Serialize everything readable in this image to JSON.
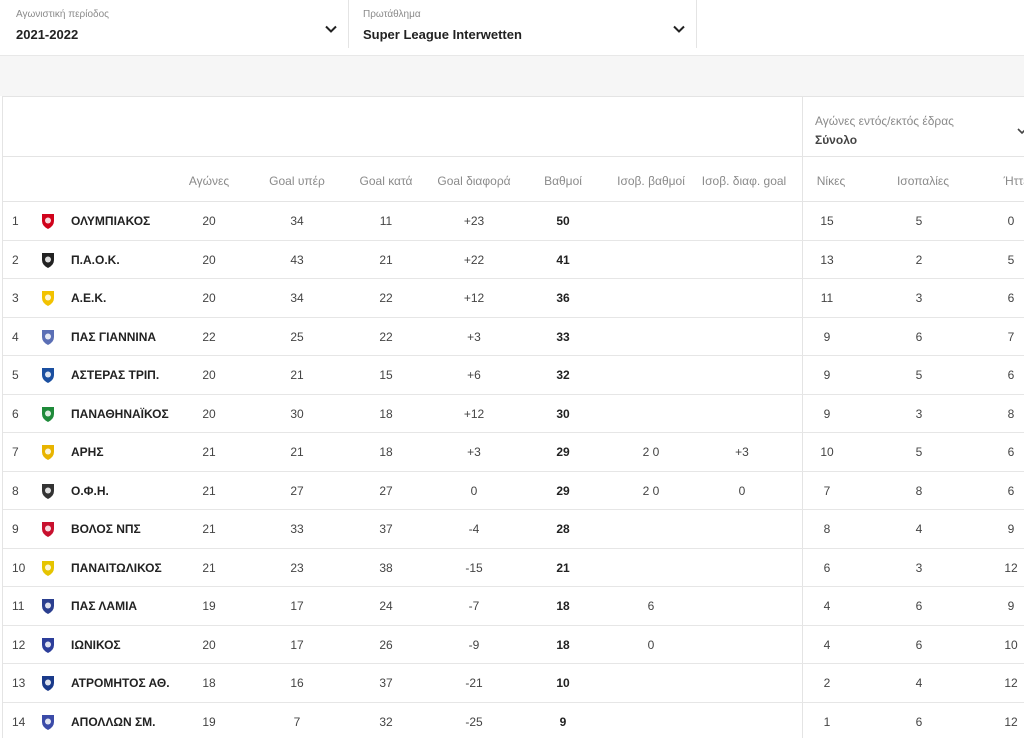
{
  "filters": {
    "season": {
      "label": "Αγωνιστική περίοδος",
      "value": "2021-2022"
    },
    "league": {
      "label": "Πρωτάθλημα",
      "value": "Super League Interwetten"
    }
  },
  "location_filter": {
    "label": "Αγώνες εντός/εκτός έδρας",
    "value": "Σύνολο"
  },
  "columns": {
    "played": "Αγώνες",
    "goals_for": "Goal υπέρ",
    "goals_against": "Goal κατά",
    "goal_diff": "Goal διαφορά",
    "points": "Βαθμοί",
    "tie_points": "Ισοβ. βαθμοί",
    "tie_goal_diff": "Ισοβ. διαφ. goal",
    "wins": "Νίκες",
    "draws": "Ισοπαλίες",
    "losses": "Ήττες"
  },
  "rows": [
    {
      "pos": "1",
      "team": "ΟΛΥΜΠΙΑΚΟΣ",
      "crest_color": "#d0021b",
      "played": "20",
      "gf": "34",
      "ga": "11",
      "gd": "+23",
      "pts": "50",
      "tie_pts": "",
      "tie_gd": "",
      "w": "15",
      "d": "5",
      "l": "0"
    },
    {
      "pos": "2",
      "team": "Π.Α.Ο.Κ.",
      "crest_color": "#222222",
      "played": "20",
      "gf": "43",
      "ga": "21",
      "gd": "+22",
      "pts": "41",
      "tie_pts": "",
      "tie_gd": "",
      "w": "13",
      "d": "2",
      "l": "5"
    },
    {
      "pos": "3",
      "team": "Α.Ε.Κ.",
      "crest_color": "#f2c200",
      "played": "20",
      "gf": "34",
      "ga": "22",
      "gd": "+12",
      "pts": "36",
      "tie_pts": "",
      "tie_gd": "",
      "w": "11",
      "d": "3",
      "l": "6"
    },
    {
      "pos": "4",
      "team": "ΠΑΣ ΓΙΑΝΝΙΝΑ",
      "crest_color": "#5b6fb5",
      "played": "22",
      "gf": "25",
      "ga": "22",
      "gd": "+3",
      "pts": "33",
      "tie_pts": "",
      "tie_gd": "",
      "w": "9",
      "d": "6",
      "l": "7"
    },
    {
      "pos": "5",
      "team": "ΑΣΤΕΡΑΣ ΤΡΙΠ.",
      "crest_color": "#1b4fa0",
      "played": "20",
      "gf": "21",
      "ga": "15",
      "gd": "+6",
      "pts": "32",
      "tie_pts": "",
      "tie_gd": "",
      "w": "9",
      "d": "5",
      "l": "6"
    },
    {
      "pos": "6",
      "team": "ΠΑΝΑΘΗΝΑΪΚΟΣ",
      "crest_color": "#1f8a3a",
      "played": "20",
      "gf": "30",
      "ga": "18",
      "gd": "+12",
      "pts": "30",
      "tie_pts": "",
      "tie_gd": "",
      "w": "9",
      "d": "3",
      "l": "8"
    },
    {
      "pos": "7",
      "team": "ΑΡΗΣ",
      "crest_color": "#e8b400",
      "played": "21",
      "gf": "21",
      "ga": "18",
      "gd": "+3",
      "pts": "29",
      "tie_pts": "2 0",
      "tie_gd": "+3",
      "w": "10",
      "d": "5",
      "l": "6"
    },
    {
      "pos": "8",
      "team": "Ο.Φ.Η.",
      "crest_color": "#333333",
      "played": "21",
      "gf": "27",
      "ga": "27",
      "gd": "0",
      "pts": "29",
      "tie_pts": "2 0",
      "tie_gd": "0",
      "w": "7",
      "d": "8",
      "l": "6"
    },
    {
      "pos": "9",
      "team": "ΒΟΛΟΣ ΝΠΣ",
      "crest_color": "#c8102e",
      "played": "21",
      "gf": "33",
      "ga": "37",
      "gd": "-4",
      "pts": "28",
      "tie_pts": "",
      "tie_gd": "",
      "w": "8",
      "d": "4",
      "l": "9"
    },
    {
      "pos": "10",
      "team": "ΠΑΝΑΙΤΩΛΙΚΟΣ",
      "crest_color": "#e5c400",
      "played": "21",
      "gf": "23",
      "ga": "38",
      "gd": "-15",
      "pts": "21",
      "tie_pts": "",
      "tie_gd": "",
      "w": "6",
      "d": "3",
      "l": "12"
    },
    {
      "pos": "11",
      "team": "ΠΑΣ ΛΑΜΙΑ",
      "crest_color": "#2b3f8f",
      "played": "19",
      "gf": "17",
      "ga": "24",
      "gd": "-7",
      "pts": "18",
      "tie_pts": "6",
      "tie_gd": "",
      "w": "4",
      "d": "6",
      "l": "9"
    },
    {
      "pos": "12",
      "team": "ΙΩΝΙΚΟΣ",
      "crest_color": "#2c3e9a",
      "played": "20",
      "gf": "17",
      "ga": "26",
      "gd": "-9",
      "pts": "18",
      "tie_pts": "0",
      "tie_gd": "",
      "w": "4",
      "d": "6",
      "l": "10"
    },
    {
      "pos": "13",
      "team": "ΑΤΡΟΜΗΤΟΣ ΑΘ.",
      "crest_color": "#1a3a8a",
      "played": "18",
      "gf": "16",
      "ga": "37",
      "gd": "-21",
      "pts": "10",
      "tie_pts": "",
      "tie_gd": "",
      "w": "2",
      "d": "4",
      "l": "12"
    },
    {
      "pos": "14",
      "team": "ΑΠΟΛΛΩΝ ΣΜ.",
      "crest_color": "#3b4ba8",
      "played": "19",
      "gf": "7",
      "ga": "32",
      "gd": "-25",
      "pts": "9",
      "tie_pts": "",
      "tie_gd": "",
      "w": "1",
      "d": "6",
      "l": "12"
    }
  ]
}
